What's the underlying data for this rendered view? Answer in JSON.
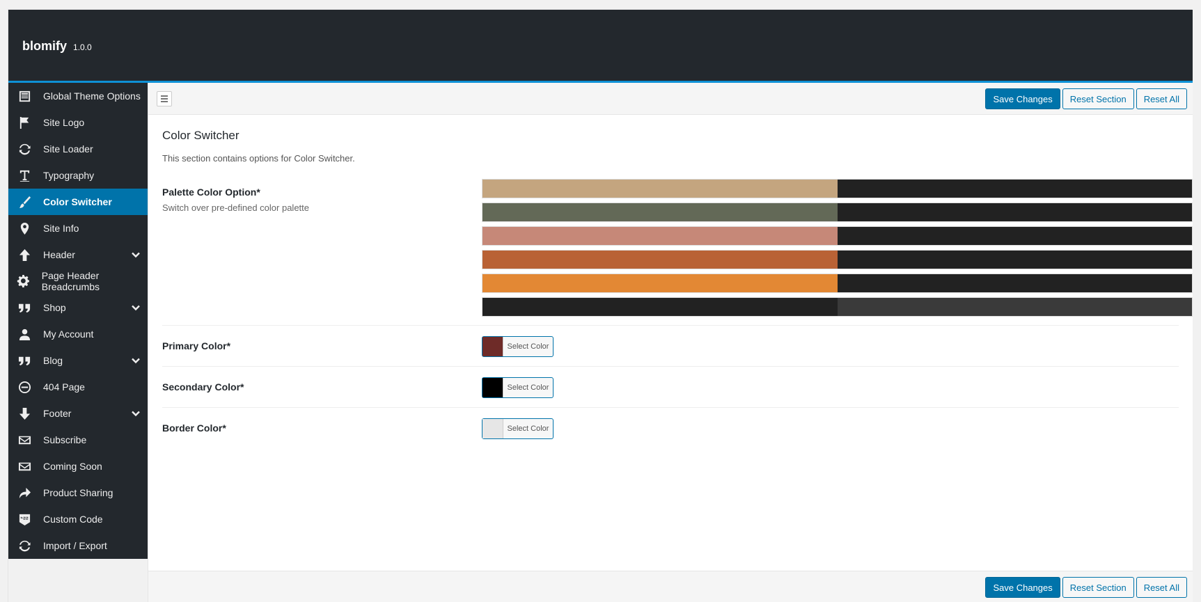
{
  "app": {
    "name": "blomify",
    "version": "1.0.0"
  },
  "sidebar": {
    "items": [
      {
        "label": "Global Theme Options",
        "icon": "layout-icon",
        "active": false,
        "has_submenu": false
      },
      {
        "label": "Site Logo",
        "icon": "flag-icon",
        "active": false,
        "has_submenu": false
      },
      {
        "label": "Site Loader",
        "icon": "refresh-icon",
        "active": false,
        "has_submenu": false
      },
      {
        "label": "Typography",
        "icon": "text-icon",
        "active": false,
        "has_submenu": false
      },
      {
        "label": "Color Switcher",
        "icon": "brush-icon",
        "active": true,
        "has_submenu": false
      },
      {
        "label": "Site Info",
        "icon": "location-pin-icon",
        "active": false,
        "has_submenu": false
      },
      {
        "label": "Header",
        "icon": "arrow-up-icon",
        "active": false,
        "has_submenu": true
      },
      {
        "label": "Page Header Breadcrumbs",
        "icon": "gear-icon",
        "active": false,
        "has_submenu": false
      },
      {
        "label": "Shop",
        "icon": "quote-icon",
        "active": false,
        "has_submenu": true
      },
      {
        "label": "My Account",
        "icon": "user-icon",
        "active": false,
        "has_submenu": false
      },
      {
        "label": "Blog",
        "icon": "quote-icon",
        "active": false,
        "has_submenu": true
      },
      {
        "label": "404 Page",
        "icon": "no-entry-icon",
        "active": false,
        "has_submenu": false
      },
      {
        "label": "Footer",
        "icon": "arrow-down-icon",
        "active": false,
        "has_submenu": true
      },
      {
        "label": "Subscribe",
        "icon": "envelope-icon",
        "active": false,
        "has_submenu": false
      },
      {
        "label": "Coming Soon",
        "icon": "envelope-icon",
        "active": false,
        "has_submenu": false
      },
      {
        "label": "Product Sharing",
        "icon": "share-arrow-icon",
        "active": false,
        "has_submenu": false
      },
      {
        "label": "Custom Code",
        "icon": "css-icon",
        "active": false,
        "has_submenu": false
      },
      {
        "label": "Import / Export",
        "icon": "refresh-icon",
        "active": false,
        "has_submenu": false
      }
    ]
  },
  "toolbar": {
    "save_label": "Save Changes",
    "reset_section_label": "Reset Section",
    "reset_all_label": "Reset All"
  },
  "section": {
    "title": "Color Switcher",
    "description": "This section contains options for Color Switcher."
  },
  "palette_field": {
    "label": "Palette Color Option*",
    "subtitle": "Switch over pre-defined color palette",
    "palettes": [
      [
        "#c4a57f",
        "#222222"
      ],
      [
        "#636957",
        "#222222"
      ],
      [
        "#c68878",
        "#222222"
      ],
      [
        "#b96235",
        "#222222"
      ],
      [
        "#e38834",
        "#222222"
      ],
      [
        "#222222",
        "#3a3a3a"
      ]
    ]
  },
  "color_fields": [
    {
      "label": "Primary Color*",
      "color": "#6e2b28",
      "button": "Select Color"
    },
    {
      "label": "Secondary Color*",
      "color": "#000000",
      "button": "Select Color"
    },
    {
      "label": "Border Color*",
      "color": "#e6e6e6",
      "button": "Select Color"
    }
  ]
}
